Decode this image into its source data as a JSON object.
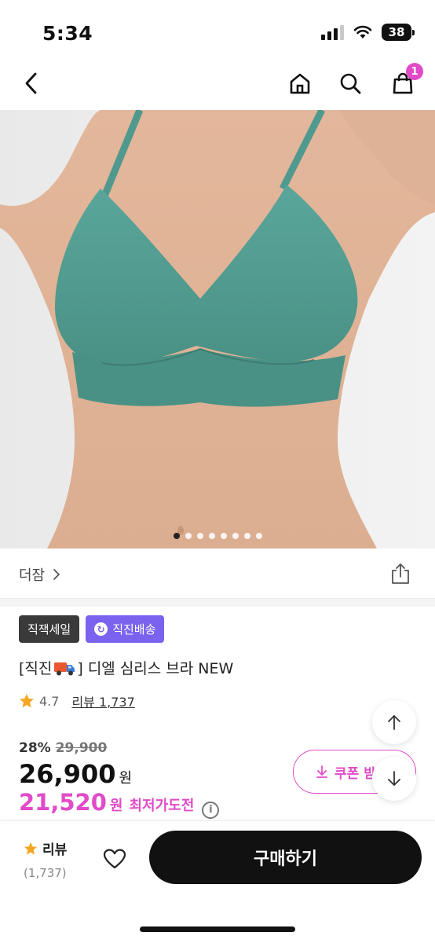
{
  "status": {
    "time": "5:34",
    "battery": "38"
  },
  "nav": {
    "cart_count": "1",
    "icons": [
      "back-arrow-icon",
      "home-icon",
      "search-icon",
      "shopping-bag-icon"
    ]
  },
  "gallery": {
    "image_count": 8,
    "active_index": 0,
    "image_description_color": "#4e9a8f"
  },
  "brand": {
    "name": "더잠",
    "chevron": "›"
  },
  "badges": {
    "sale": "직잭세일",
    "delivery": "직진배송"
  },
  "product": {
    "title_prefix": "[직진",
    "title_suffix": "] 디엘 심리스 브라 NEW",
    "rating": "4.7",
    "review_label": "리뷰 1,737"
  },
  "price": {
    "discount_pct": "28%",
    "original": "29,900",
    "current": "26,900",
    "currency": "원",
    "best": "21,520",
    "best_label": "최저가도전"
  },
  "coupon": {
    "label": "쿠폰 받"
  },
  "bottom": {
    "review_title": "리뷰",
    "review_count": "(1,737)",
    "buy_label": "구매하기"
  },
  "colors": {
    "accent": "#e14bc8",
    "delivery_badge": "#7b63f0",
    "star": "#f5a623"
  }
}
